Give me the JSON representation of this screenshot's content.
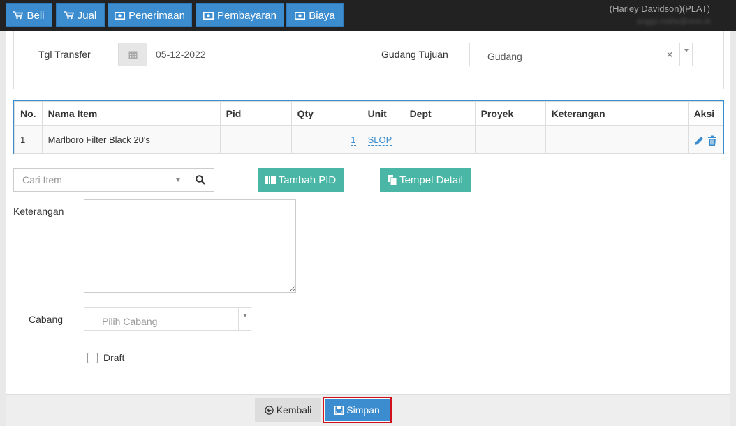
{
  "topbar": {
    "buttons": [
      {
        "label": "Beli",
        "icon": "cart-icon"
      },
      {
        "label": "Jual",
        "icon": "cart-icon"
      },
      {
        "label": "Penerimaan",
        "icon": "money-icon"
      },
      {
        "label": "Pembayaran",
        "icon": "money-icon"
      },
      {
        "label": "Biaya",
        "icon": "money-icon"
      }
    ],
    "company": "(Harley Davidson)(PLAT)",
    "email": "anggo.mahe@rexe.id"
  },
  "form": {
    "tgl_transfer_label": "Tgl Transfer",
    "tgl_transfer_value": "05-12-2022",
    "gudang_tujuan_label": "Gudang Tujuan",
    "gudang_tujuan_value": "Gudang",
    "clear_symbol": "×"
  },
  "table": {
    "headers": [
      "No.",
      "Nama Item",
      "Pid",
      "Qty",
      "Unit",
      "Dept",
      "Proyek",
      "Keterangan",
      "Aksi"
    ],
    "rows": [
      {
        "no": "1",
        "nama_item": "Marlboro Filter Black 20's",
        "pid": "",
        "qty": "1",
        "unit": "SLOP",
        "dept": "",
        "proyek": "",
        "keterangan": ""
      }
    ]
  },
  "search": {
    "placeholder": "Cari Item"
  },
  "buttons": {
    "tambah_pid": "Tambah PID",
    "tempel_detail": "Tempel Detail",
    "kembali": "Kembali",
    "simpan": "Simpan"
  },
  "keterangan_label": "Keterangan",
  "cabang": {
    "label": "Cabang",
    "placeholder": "Pilih Cabang"
  },
  "draft_label": "Draft",
  "colors": {
    "primary": "#3c8dcf",
    "teal": "#49b6a6",
    "topbar": "#222222",
    "highlight": "#d0111b"
  }
}
